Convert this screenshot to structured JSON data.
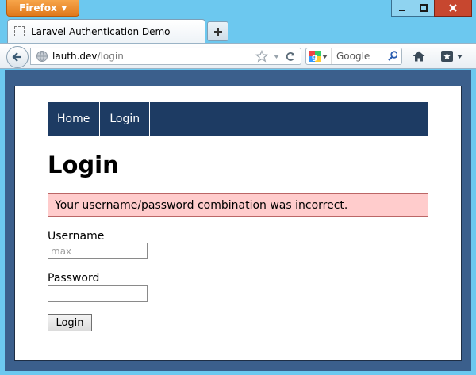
{
  "window": {
    "menu_label": "Firefox",
    "menu_caret": "▼",
    "minimize_icon": "minimize-icon",
    "maximize_icon": "maximize-icon",
    "close_icon": "close-icon",
    "accent_color": "#6cc8ef"
  },
  "tabs": [
    {
      "title": "Laravel Authentication Demo",
      "active": true
    }
  ],
  "new_tab_label": "+",
  "toolbar": {
    "url_host": "lauth.dev",
    "url_path": "/login",
    "search_placeholder": "Google",
    "bookmark_star_icon": "star-icon",
    "reload_icon": "reload-icon",
    "home_icon": "home-icon",
    "bookmarks_menu_icon": "bookmarks-icon"
  },
  "site": {
    "nav": [
      {
        "label": "Home"
      },
      {
        "label": "Login"
      }
    ],
    "nav_color": "#1d3b63",
    "page_title": "Login",
    "error_message": "Your username/password combination was incorrect.",
    "error_bg": "#ffcccc",
    "form": {
      "username_label": "Username",
      "username_value": "",
      "username_placeholder": "max",
      "password_label": "Password",
      "password_value": "",
      "submit_label": "Login"
    }
  }
}
